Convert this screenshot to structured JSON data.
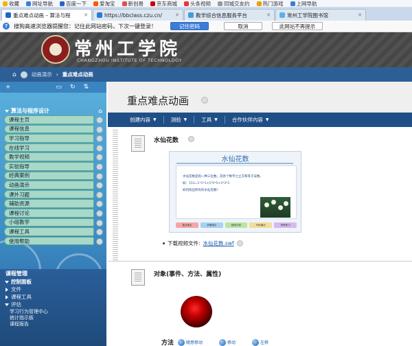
{
  "bookmarks": [
    "收藏",
    "网址导航",
    "百度一下",
    "爱淘宝",
    "新创易",
    "京东商城",
    "头条视频",
    "同城交友约",
    "热门游戏",
    "上网导航"
  ],
  "tabs": [
    {
      "label": "重点难点动画 – 算法与程",
      "active": true,
      "color": "#1e66c8"
    },
    {
      "label": "https://bbclass.czu.cn/",
      "active": false,
      "color": "#2b7bd6"
    },
    {
      "label": "教学综合信息服务平台",
      "active": false,
      "color": "#3d9de0"
    },
    {
      "label": "常州工学院图书馆",
      "active": false,
      "color": "#5cb0e8"
    }
  ],
  "password_prompt": {
    "message": "搜狗高速浏览器提醒您：记住此网站密码，下次一键登录！",
    "remember": "记住密码",
    "cancel": "取消",
    "never": "此网站不再提示"
  },
  "header": {
    "school_cn": "常州工学院",
    "school_en": "CHANGZHOU INSTITUTE OF TECHNOLOGY"
  },
  "breadcrumb": {
    "parent": "动画演示",
    "separator": "›",
    "current": "重点难点动画"
  },
  "sidebar": {
    "course_title": "算法与程序设计",
    "items": [
      "课程主页",
      "课程信息",
      "学习指导",
      "在线学习",
      "教学视频",
      "实验指导",
      "经典案例",
      "动画演示",
      "课外习题",
      "辅助资源",
      "课程讨论",
      "小组教学",
      "课程工具",
      "使用帮助"
    ],
    "management": "课程管理",
    "control_panel": "控制面板",
    "files": "文件",
    "course_tools": "课程工具",
    "evaluation": "评估",
    "eval_items": [
      "学习行为管理中心",
      "统计指示板",
      "课程报告"
    ]
  },
  "content": {
    "title": "重点难点动画",
    "menu": [
      "创建内容",
      "测验",
      "工具",
      "合作伙伴内容"
    ],
    "item1": {
      "title": "水仙花数",
      "shot_title": "水仙花数",
      "shot_text": [
        "水仙花数是指一种三位数，其各个数字之立方和等于该数。",
        "如：153=1*1*1+5*5*5+3*3*3",
        "如何找出所有的水仙花数？"
      ],
      "shot_buttons": [
        "重点难点",
        "步骤演示",
        "程序分析",
        "代码演示",
        "思考练习"
      ],
      "download_label": "下载视频文件:",
      "download_link": "水仙花数.swf"
    },
    "item2": {
      "title": "对象(事件、方法、属性)",
      "method_label": "方法",
      "methods": [
        "随意移动",
        "移动",
        "左移"
      ]
    }
  }
}
